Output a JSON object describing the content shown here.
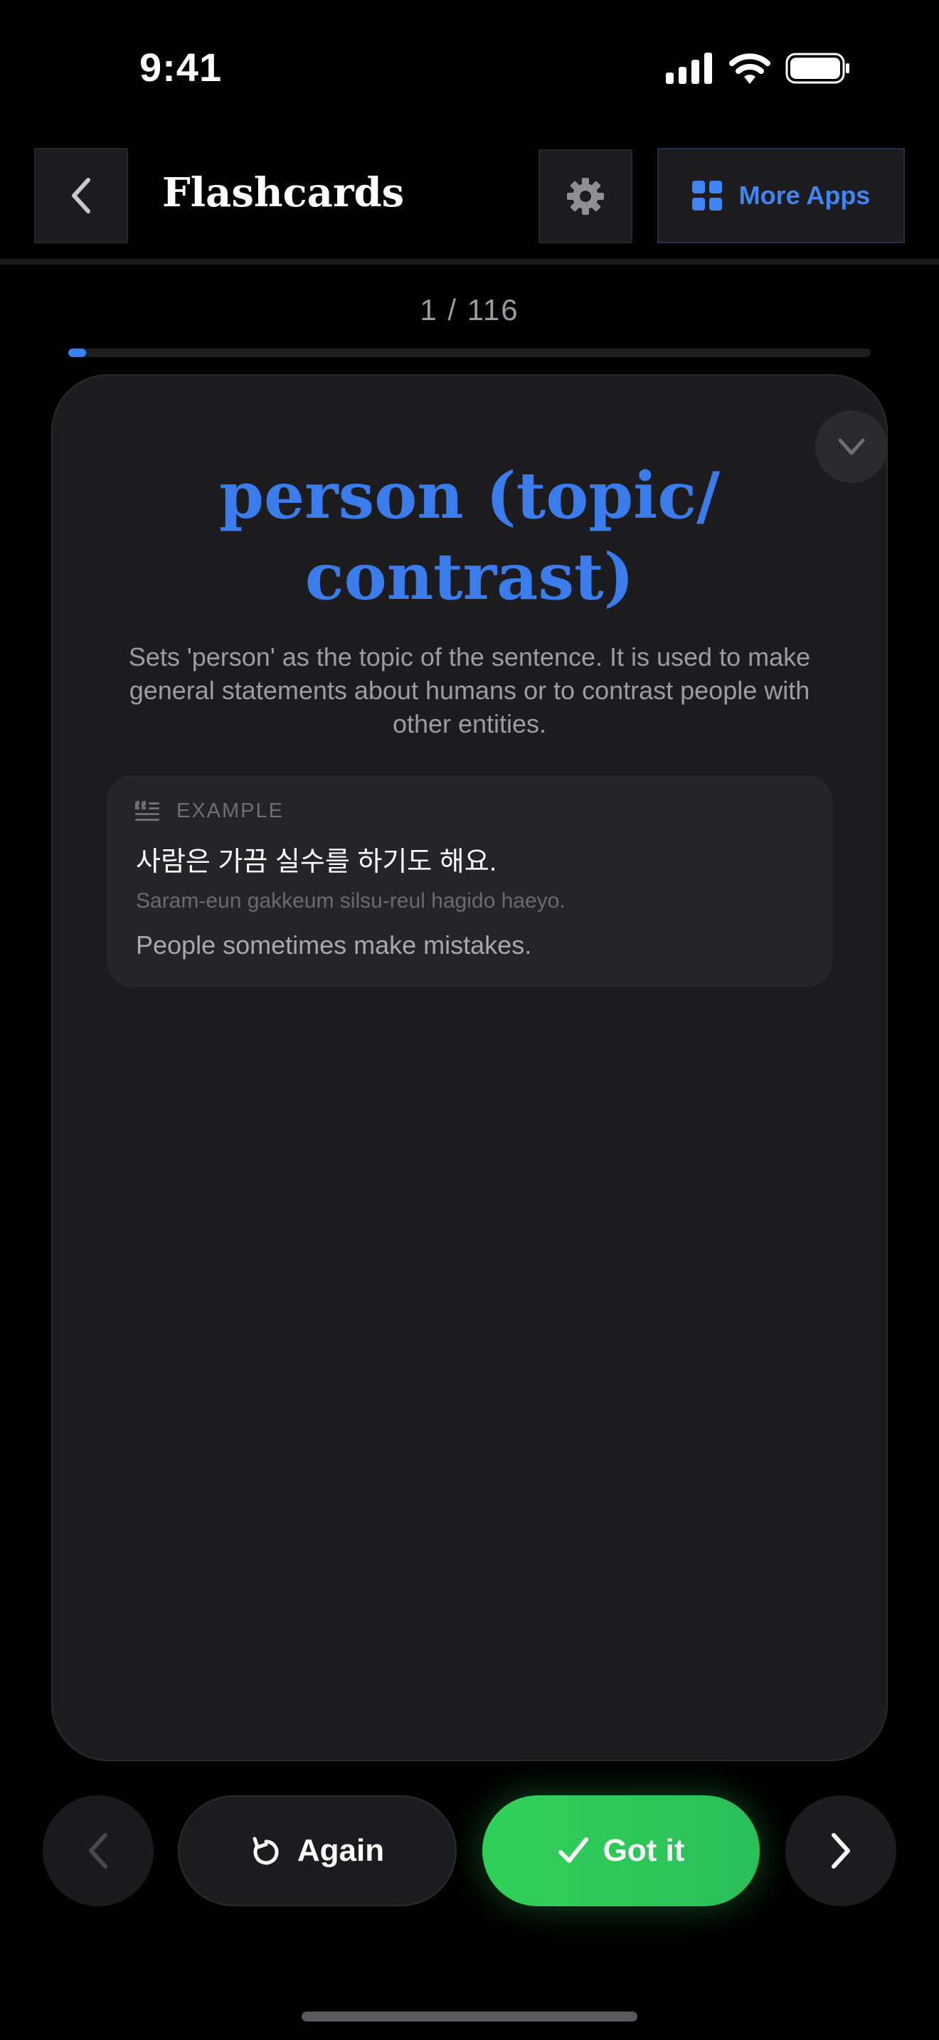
{
  "status_bar": {
    "time": "9:41",
    "icons": [
      "cellular-signal-icon",
      "wifi-icon",
      "battery-icon"
    ]
  },
  "header": {
    "title": "Flashcards",
    "back_icon": "chevron-left-icon",
    "settings_icon": "gear-icon",
    "more_apps_label": "More Apps",
    "more_apps_icon": "grid-icon"
  },
  "progress": {
    "counter": "1 / 116",
    "current": 1,
    "total": 116
  },
  "card": {
    "term": "person (topic/ contrast)",
    "definition": "Sets 'person' as the topic of the sentence. It is used to make general statements about humans or to contrast people with other entities.",
    "example": {
      "label": "EXAMPLE",
      "korean": "사람은 가끔 실수를 하기도 해요.",
      "romanization": "Saram-eun gakkeum silsu-reul hagido haeyo.",
      "english": "People sometimes make mistakes."
    },
    "collapse_icon": "chevron-down-icon"
  },
  "controls": {
    "again_label": "Again",
    "got_it_label": "Got it",
    "prev_icon": "chevron-left-icon",
    "next_icon": "chevron-right-icon"
  },
  "colors": {
    "accent_blue": "#3a7cec",
    "success_green": "#30d158",
    "card_bg": "#1c1c1e"
  }
}
